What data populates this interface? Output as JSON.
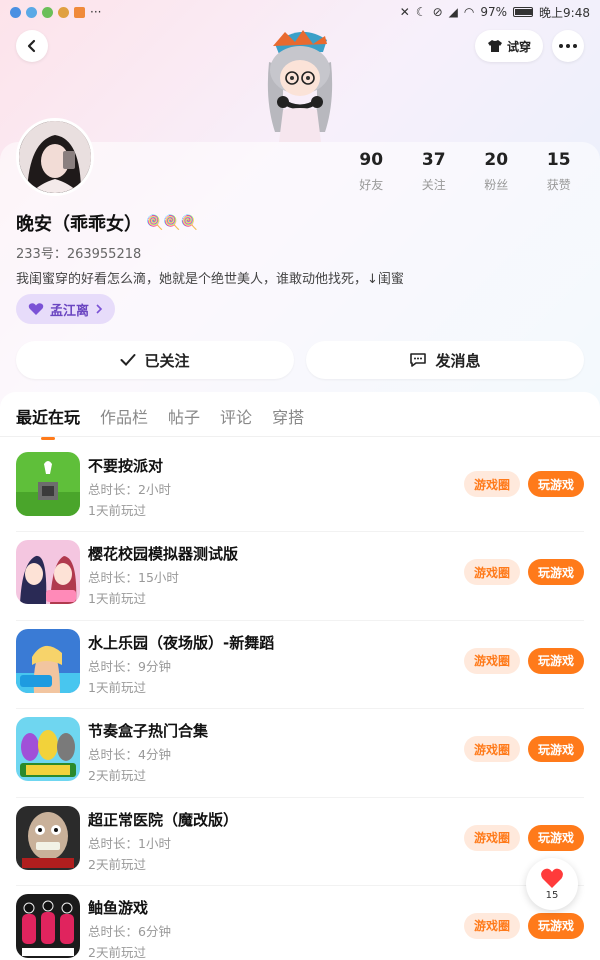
{
  "status_bar": {
    "battery": "97%",
    "time": "晚上9:48"
  },
  "header": {
    "try_on_label": "试穿"
  },
  "profile": {
    "stats": [
      {
        "value": "90",
        "label": "好友"
      },
      {
        "value": "37",
        "label": "关注"
      },
      {
        "value": "20",
        "label": "粉丝"
      },
      {
        "value": "15",
        "label": "获赞"
      }
    ],
    "nickname": "晚安（乖乖女）",
    "nickname_emoji": "🍭🍭🍭",
    "uid": "233号：263955218",
    "bio": "我闺蜜穿的好看怎么滴，她就是个绝世美人，谁敢动他找死，↓闺蜜",
    "tag_label": "孟江离",
    "followed_label": "已关注",
    "message_label": "发消息"
  },
  "tabs": [
    "最近在玩",
    "作品栏",
    "帖子",
    "评论",
    "穿搭"
  ],
  "colors": {
    "accent": "#ff7a1a",
    "tag_purple": "#6b46c1"
  },
  "games": [
    {
      "name": "不要按派对",
      "duration": "总时长：2小时",
      "last_played": "1天前玩过",
      "circle_label": "游戏圈",
      "play_label": "玩游戏"
    },
    {
      "name": "樱花校园模拟器测试版",
      "duration": "总时长：15小时",
      "last_played": "1天前玩过",
      "circle_label": "游戏圈",
      "play_label": "玩游戏"
    },
    {
      "name": "水上乐园（夜场版）-新舞蹈",
      "duration": "总时长：9分钟",
      "last_played": "1天前玩过",
      "circle_label": "游戏圈",
      "play_label": "玩游戏"
    },
    {
      "name": "节奏盒子热门合集",
      "duration": "总时长：4分钟",
      "last_played": "2天前玩过",
      "circle_label": "游戏圈",
      "play_label": "玩游戏"
    },
    {
      "name": "超正常医院（魔改版）",
      "duration": "总时长：1小时",
      "last_played": "2天前玩过",
      "circle_label": "游戏圈",
      "play_label": "玩游戏"
    },
    {
      "name": "鲉鱼游戏",
      "duration": "总时长：6分钟",
      "last_played": "2天前玩过",
      "circle_label": "游戏圈",
      "play_label": "玩游戏"
    }
  ],
  "like_fab": {
    "count": "15"
  }
}
